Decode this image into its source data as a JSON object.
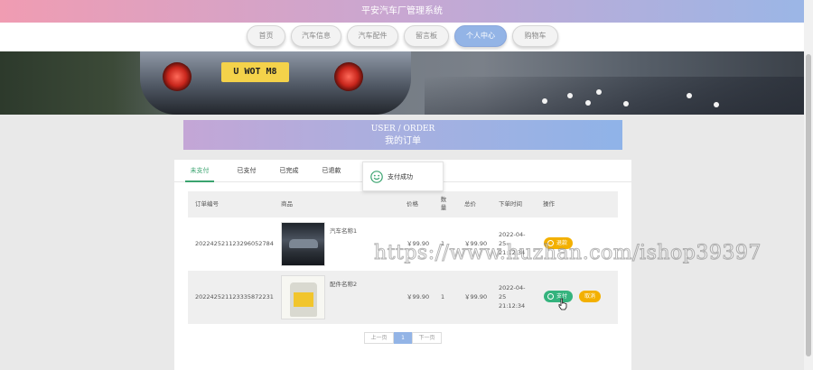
{
  "header": {
    "title": "平安汽车厂管理系统"
  },
  "nav": {
    "items": [
      {
        "label": "首页",
        "active": false
      },
      {
        "label": "汽车信息",
        "active": false
      },
      {
        "label": "汽车配件",
        "active": false
      },
      {
        "label": "留言板",
        "active": false
      },
      {
        "label": "个人中心",
        "active": true
      },
      {
        "label": "购物车",
        "active": false
      }
    ]
  },
  "banner": {
    "plate_text": "U WOT M8"
  },
  "page_title": {
    "en": "USER / ORDER",
    "cn": "我的订单"
  },
  "tabs": [
    {
      "label": "未支付",
      "active": true
    },
    {
      "label": "已支付",
      "active": false
    },
    {
      "label": "已完成",
      "active": false
    },
    {
      "label": "已退款",
      "active": false
    }
  ],
  "toast": {
    "icon": "smile-icon",
    "text": "支付成功"
  },
  "table": {
    "headers": {
      "order_no": "订单编号",
      "product": "商品",
      "price": "价格",
      "qty_line1": "数",
      "qty_line2": "量",
      "total": "总价",
      "time": "下单时间",
      "action": "操作"
    },
    "rows": [
      {
        "order_no": "202242521123296052784",
        "product_name": "汽车名称1",
        "price": "￥99.90",
        "qty": "1",
        "total": "￥99.90",
        "date_line1": "2022-04-",
        "date_line2": "25",
        "date_line3": "21:12:34",
        "actions": [
          {
            "label": "退款",
            "color": "#f3b000",
            "icon": "refund-icon"
          }
        ]
      },
      {
        "order_no": "202242521123335872231",
        "product_name": "配件名称2",
        "price": "￥99.90",
        "qty": "1",
        "total": "￥99.90",
        "date_line1": "2022-04-",
        "date_line2": "25",
        "date_line3": "21:12:34",
        "actions": [
          {
            "label": "支付",
            "color": "#34b37d",
            "icon": "pay-icon"
          },
          {
            "label": "取消",
            "color": "#f3b000"
          }
        ]
      }
    ]
  },
  "pager": {
    "prev": "上一页",
    "current": "1",
    "next": "下一页"
  },
  "watermark": "https://www.huzhan.com/ishop39397",
  "colors": {
    "accent_green": "#3aa36f",
    "accent_blue": "#93b4e6",
    "warning": "#f3b000"
  }
}
